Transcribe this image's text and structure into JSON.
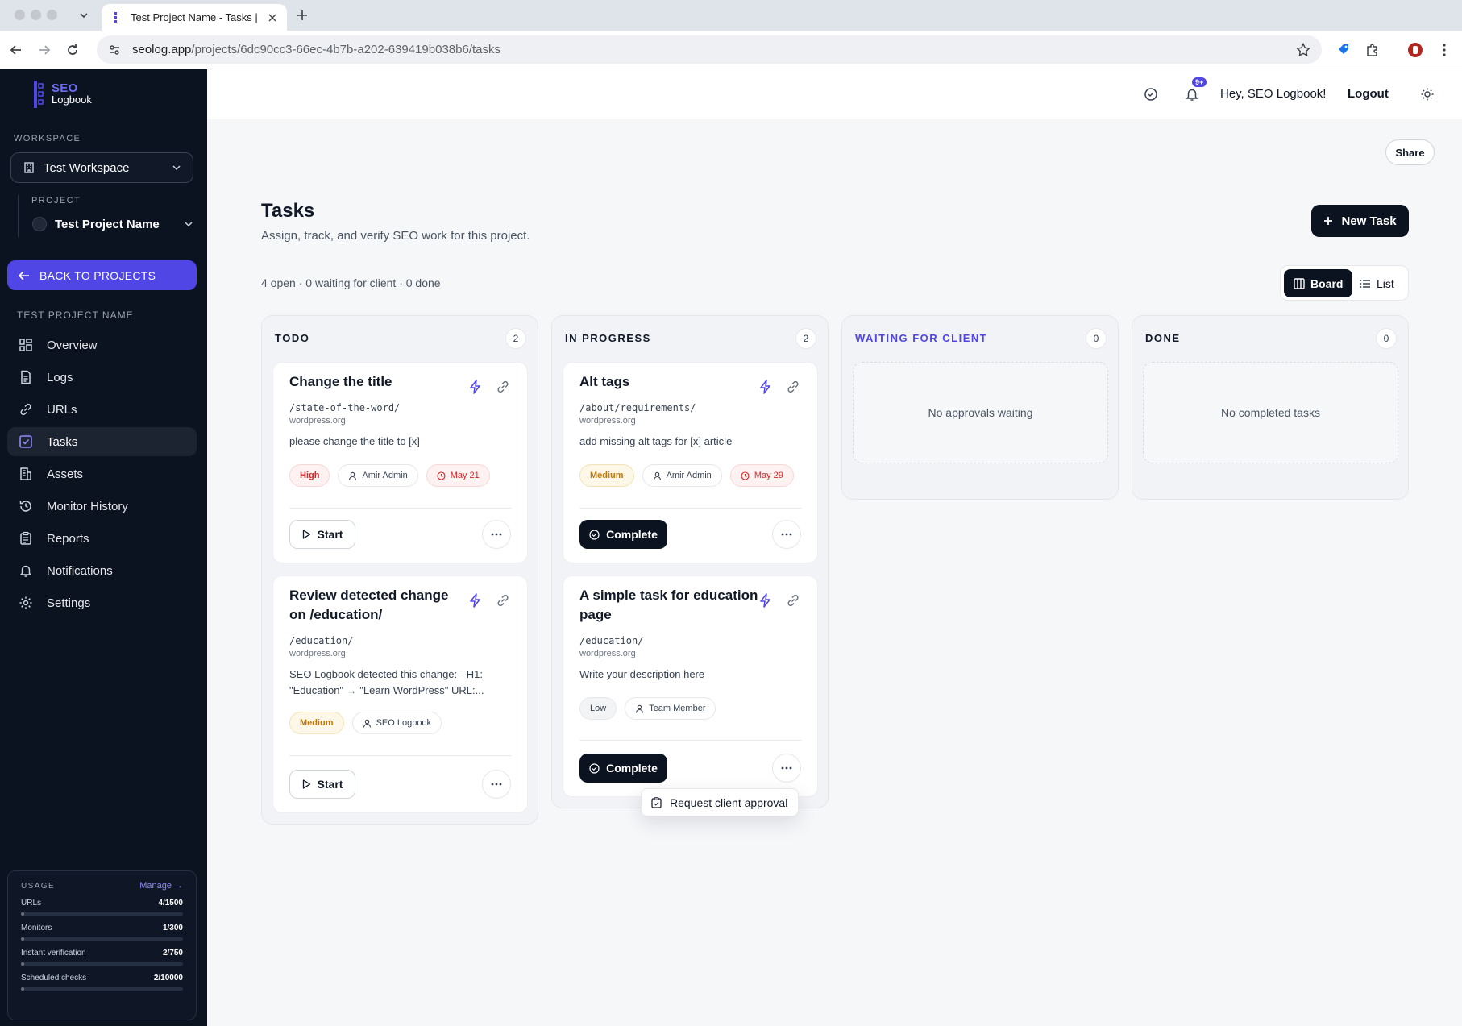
{
  "browser": {
    "tab_title": "Test Project Name - Tasks | S",
    "url_host": "seolog.app",
    "url_path": "/projects/6dc90cc3-66ec-4b7b-a202-639419b038b6/tasks"
  },
  "logo": {
    "line1": "SEO",
    "line2": "Logbook"
  },
  "sidebar": {
    "workspace_label": "WORKSPACE",
    "workspace_value": "Test Workspace",
    "project_label": "PROJECT",
    "project_value": "Test Project Name",
    "back_label": "BACK TO PROJECTS",
    "section_title": "TEST PROJECT NAME",
    "items": [
      {
        "label": "Overview",
        "icon": "grid-icon"
      },
      {
        "label": "Logs",
        "icon": "file-icon"
      },
      {
        "label": "URLs",
        "icon": "link-icon"
      },
      {
        "label": "Tasks",
        "icon": "checkbox-icon",
        "active": true
      },
      {
        "label": "Assets",
        "icon": "buildings-icon"
      },
      {
        "label": "Monitor History",
        "icon": "history-icon"
      },
      {
        "label": "Reports",
        "icon": "clipboard-icon"
      },
      {
        "label": "Notifications",
        "icon": "bell-icon"
      },
      {
        "label": "Settings",
        "icon": "gear-icon"
      }
    ],
    "usage": {
      "title": "USAGE",
      "manage": "Manage →",
      "rows": [
        {
          "label": "URLs",
          "value": "4/1500",
          "fraction": 0.003
        },
        {
          "label": "Monitors",
          "value": "1/300",
          "fraction": 0.003
        },
        {
          "label": "Instant verification",
          "value": "2/750",
          "fraction": 0.003
        },
        {
          "label": "Scheduled checks",
          "value": "2/10000",
          "fraction": 0.0002
        }
      ]
    }
  },
  "topbar": {
    "notif_badge": "9+",
    "greeting": "Hey, SEO Logbook!",
    "logout": "Logout"
  },
  "main": {
    "share": "Share",
    "title": "Tasks",
    "subtitle": "Assign, track, and verify SEO work for this project.",
    "new_task": "New Task",
    "stats": "4 open · 0 waiting for client · 0 done",
    "view_board": "Board",
    "view_list": "List"
  },
  "columns": {
    "todo": {
      "title": "TODO",
      "count": "2"
    },
    "in_progress": {
      "title": "IN PROGRESS",
      "count": "2"
    },
    "waiting": {
      "title": "WAITING FOR CLIENT",
      "count": "0",
      "empty": "No approvals waiting"
    },
    "done": {
      "title": "DONE",
      "count": "0",
      "empty": "No completed tasks"
    }
  },
  "cards": {
    "c1": {
      "title": "Change the title",
      "path": "/state-of-the-word/",
      "domain": "wordpress.org",
      "desc": "please change the title to [x]",
      "priority": "High",
      "assignee": "Amir Admin",
      "due": "May 21",
      "action": "Start"
    },
    "c2": {
      "title_l1": "Review detected change",
      "title_l2": "on /education/",
      "path": "/education/",
      "domain": "wordpress.org",
      "desc_l1": "SEO Logbook detected this change: - H1:",
      "desc_l2": "\"Education\" → \"Learn WordPress\" URL:...",
      "priority": "Medium",
      "assignee": "SEO Logbook",
      "action": "Start"
    },
    "c3": {
      "title": "Alt tags",
      "path": "/about/requirements/",
      "domain": "wordpress.org",
      "desc": "add missing alt tags for [x] article",
      "priority": "Medium",
      "assignee": "Amir Admin",
      "due": "May 29",
      "action": "Complete"
    },
    "c4": {
      "title_l1": "A simple task for education",
      "title_l2": "page",
      "path": "/education/",
      "domain": "wordpress.org",
      "desc": "Write your description here",
      "priority": "Low",
      "assignee": "Team Member",
      "action": "Complete"
    }
  },
  "popover": {
    "label": "Request client approval"
  }
}
